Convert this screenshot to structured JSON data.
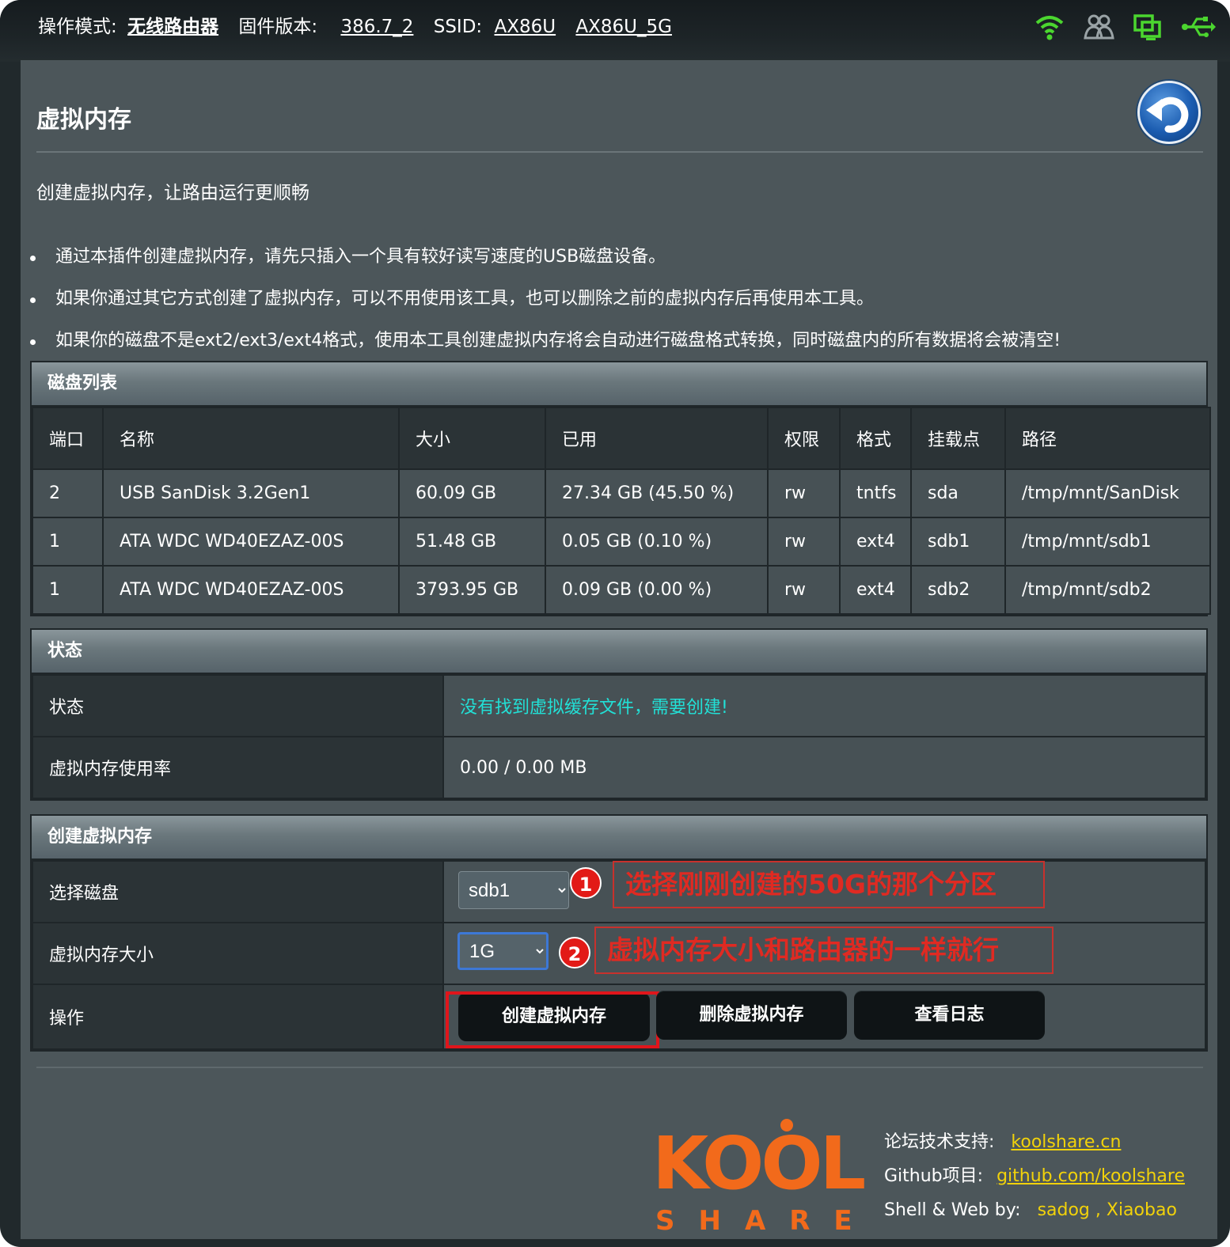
{
  "topbar": {
    "mode_label": "操作模式:",
    "mode_value": "无线路由器",
    "firmware_label": "固件版本:",
    "firmware_value": "386.7_2",
    "ssid_label": "SSID:",
    "ssid_1": "AX86U",
    "ssid_2": "AX86U_5G",
    "icons": [
      "wifi-icon",
      "clients-icon",
      "network-icon",
      "usb-icon"
    ]
  },
  "page": {
    "title": "虚拟内存",
    "subtitle": "创建虚拟内存，让路由运行更顺畅",
    "notes": [
      "通过本插件创建虚拟内存，请先只插入一个具有较好读写速度的USB磁盘设备。",
      "如果你通过其它方式创建了虚拟内存，可以不用使用该工具，也可以删除之前的虚拟内存后再使用本工具。",
      "如果你的磁盘不是ext2/ext3/ext4格式，使用本工具创建虚拟内存将会自动进行磁盘格式转换，同时磁盘内的所有数据将会被清空!"
    ]
  },
  "disk_list": {
    "header": "磁盘列表",
    "columns": [
      "端口",
      "名称",
      "大小",
      "已用",
      "权限",
      "格式",
      "挂载点",
      "路径"
    ],
    "rows": [
      [
        "2",
        "USB SanDisk 3.2Gen1",
        "60.09 GB",
        "27.34 GB (45.50 %)",
        "rw",
        "tntfs",
        "sda",
        "/tmp/mnt/SanDisk"
      ],
      [
        "1",
        "ATA WDC WD40EZAZ-00S",
        "51.48 GB",
        "0.05 GB (0.10 %)",
        "rw",
        "ext4",
        "sdb1",
        "/tmp/mnt/sdb1"
      ],
      [
        "1",
        "ATA WDC WD40EZAZ-00S",
        "3793.95 GB",
        "0.09 GB (0.00 %)",
        "rw",
        "ext4",
        "sdb2",
        "/tmp/mnt/sdb2"
      ]
    ]
  },
  "status": {
    "header": "状态",
    "status_label": "状态",
    "status_value": "没有找到虚拟缓存文件，需要创建!",
    "usage_label": "虚拟内存使用率",
    "usage_value": "0.00 / 0.00 MB"
  },
  "create": {
    "header": "创建虚拟内存",
    "disk_label": "选择磁盘",
    "disk_value": "sdb1",
    "size_label": "虚拟内存大小",
    "size_value": "1G",
    "action_label": "操作",
    "btn_create": "创建虚拟内存",
    "btn_delete": "删除虚拟内存",
    "btn_log": "查看日志"
  },
  "annotations": {
    "badge_1": "1",
    "note_1": "选择刚刚创建的50G的那个分区",
    "badge_2": "2",
    "note_2": "虚拟内存大小和路由器的一样就行"
  },
  "footer": {
    "forum_label": "论坛技术支持:",
    "forum_link": "koolshare.cn",
    "github_label": "Github项目:",
    "github_link": "github.com/koolshare",
    "credits_label": "Shell & Web by:",
    "credits_value": "sadog , Xiaobao",
    "logo_text": "KOOL",
    "logo_sub": "SHARE"
  },
  "colors": {
    "accent_status": "#22e0d6",
    "annotation_red": "#e02a22",
    "footer_yellow": "#f2d20a",
    "logo_orange": "#f26a1b"
  }
}
